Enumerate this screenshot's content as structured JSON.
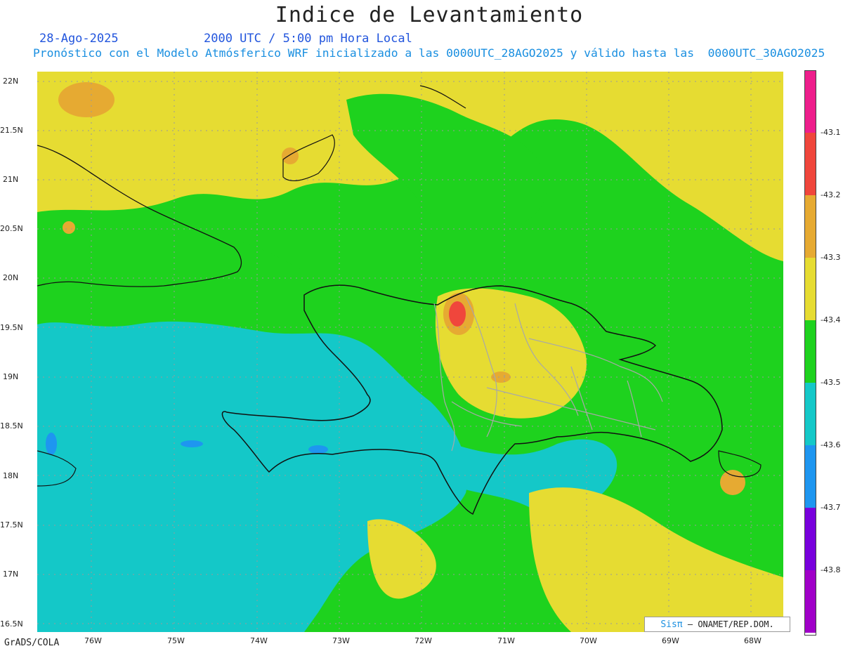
{
  "title": "Indice de Levantamiento",
  "date": "28-Ago-2025",
  "valid_time": "2000 UTC / 5:00 pm Hora Local",
  "description": "Pronóstico con el Modelo Atmósferico WRF inicializado a las 0000UTC_28AGO2025 y válido hasta las  0000UTC_30AGO2025",
  "lat_labels": [
    "22N",
    "21.5N",
    "21N",
    "20.5N",
    "20N",
    "19.5N",
    "19N",
    "18.5N",
    "18N",
    "17.5N",
    "17N",
    "16.5N"
  ],
  "lon_labels": [
    "76W",
    "75W",
    "74W",
    "73W",
    "72W",
    "71W",
    "70W",
    "69W",
    "68W"
  ],
  "colorbar": {
    "labels": [
      "-43.1",
      "-43.2",
      "-43.3",
      "-43.4",
      "-43.5",
      "-43.6",
      "-43.7",
      "-43.8"
    ],
    "colors": [
      "#ee1e8c",
      "#f0463c",
      "#e6aa32",
      "#e6dc32",
      "#1ed21e",
      "#14c8c8",
      "#1e96f0",
      "#7800dc",
      "#a000c8"
    ]
  },
  "legend_colors": {
    "ocean": "#14c8c8",
    "green": "#1ed21e",
    "yellow": "#e6dc32",
    "orange": "#e6aa32",
    "red": "#f0463c",
    "blue": "#1e96f0"
  },
  "footer": "GrADS/COLA",
  "credit": {
    "logo": "Sisπ",
    "text": "ONAMET/REP.DOM."
  }
}
